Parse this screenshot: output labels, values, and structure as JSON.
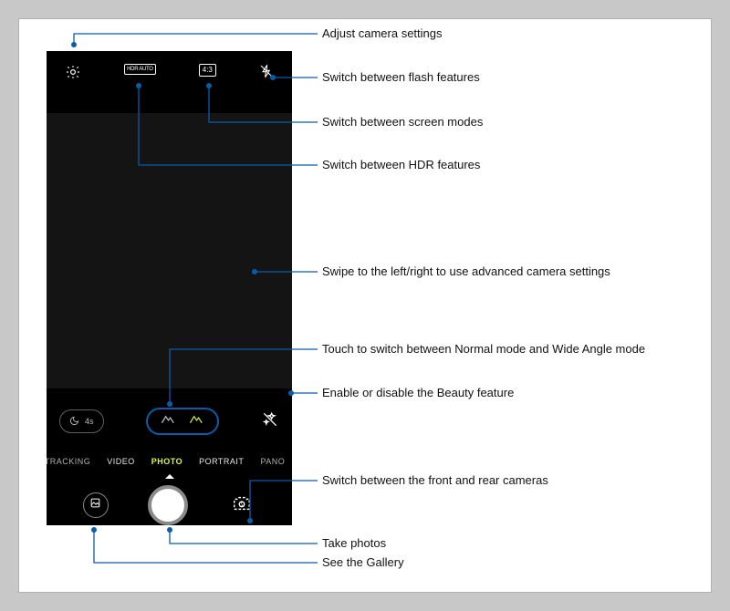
{
  "phone": {
    "top_icons": {
      "settings": "settings",
      "hdr": "HDR AUTO",
      "ratio": "4:3",
      "flash": "flash-off"
    },
    "timer_label": "4s",
    "modes": {
      "tracking": "TRACKING",
      "video": "VIDEO",
      "photo": "PHOTO",
      "portrait": "PORTRAIT",
      "pano": "PANO"
    }
  },
  "callouts": {
    "settings": "Adjust camera settings",
    "flash": "Switch between flash features",
    "screen_modes": "Switch between screen modes",
    "hdr": "Switch between HDR features",
    "swipe": "Swipe to the left/right to use advanced camera settings",
    "wide_angle": "Touch to switch between Normal mode and Wide Angle mode",
    "beauty": "Enable or disable the Beauty feature",
    "switch_cam": "Switch between the front and rear cameras",
    "take_photos": "Take photos",
    "gallery": "See the Gallery"
  }
}
